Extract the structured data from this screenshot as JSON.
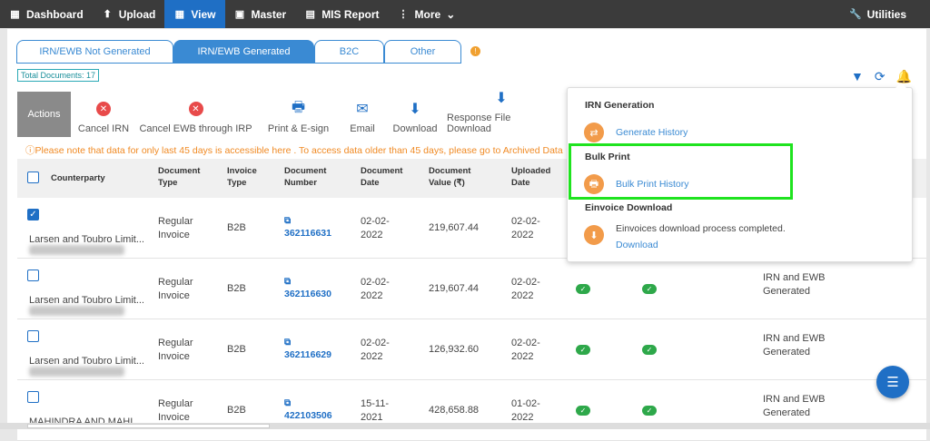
{
  "nav": {
    "dashboard": "Dashboard",
    "upload": "Upload",
    "view": "View",
    "master": "Master",
    "mis": "MIS Report",
    "more": "More",
    "utilities": "Utilities"
  },
  "tabs": [
    "IRN/EWB Not Generated",
    "IRN/EWB Generated",
    "B2C",
    "Other"
  ],
  "total": "Total Documents: 17",
  "actions": {
    "label": "Actions",
    "items": [
      "Cancel IRN",
      "Cancel EWB through IRP",
      "Print & E-sign",
      "Email",
      "Download",
      "Response File Download"
    ]
  },
  "note": "Please note that data for only last 45 days is accessible here . To access data older than 45 days, please go to Archived Data",
  "headers": {
    "counterparty": "Counterparty",
    "doctype": "Document Type",
    "invtype": "Invoice Type",
    "docnum": "Document Number",
    "docdate": "Document Date",
    "docvalue": "Document Value (₹)",
    "uploaded": "Uploaded Date"
  },
  "rows": [
    {
      "name": "Larsen and Toubro Limit...",
      "doctype": "Regular Invoice",
      "invtype": "B2B",
      "docnum": "362116631",
      "docdate": "02-02-2022",
      "value": "219,607.44",
      "uploaded": "02-02-2022",
      "status": ""
    },
    {
      "name": "Larsen and Toubro Limit...",
      "doctype": "Regular Invoice",
      "invtype": "B2B",
      "docnum": "362116630",
      "docdate": "02-02-2022",
      "value": "219,607.44",
      "uploaded": "02-02-2022",
      "status": "IRN and EWB Generated"
    },
    {
      "name": "Larsen and Toubro Limit...",
      "doctype": "Regular Invoice",
      "invtype": "B2B",
      "docnum": "362116629",
      "docdate": "02-02-2022",
      "value": "126,932.60",
      "uploaded": "02-02-2022",
      "status": "IRN and EWB Generated"
    },
    {
      "name": "MAHINDRA AND MAHI...",
      "doctype": "Regular Invoice",
      "invtype": "B2B",
      "docnum": "422103506",
      "docdate": "15-11-2021",
      "value": "428,658.88",
      "uploaded": "01-02-2022",
      "status": "IRN and EWB Generated"
    }
  ],
  "popup": {
    "irn_title": "IRN Generation",
    "irn_link": "Generate History",
    "bulk_title": "Bulk Print",
    "bulk_link": "Bulk Print History",
    "einv_title": "Einvoice Download",
    "einv_msg": "Einvoices download process completed.",
    "einv_link": "Download"
  }
}
